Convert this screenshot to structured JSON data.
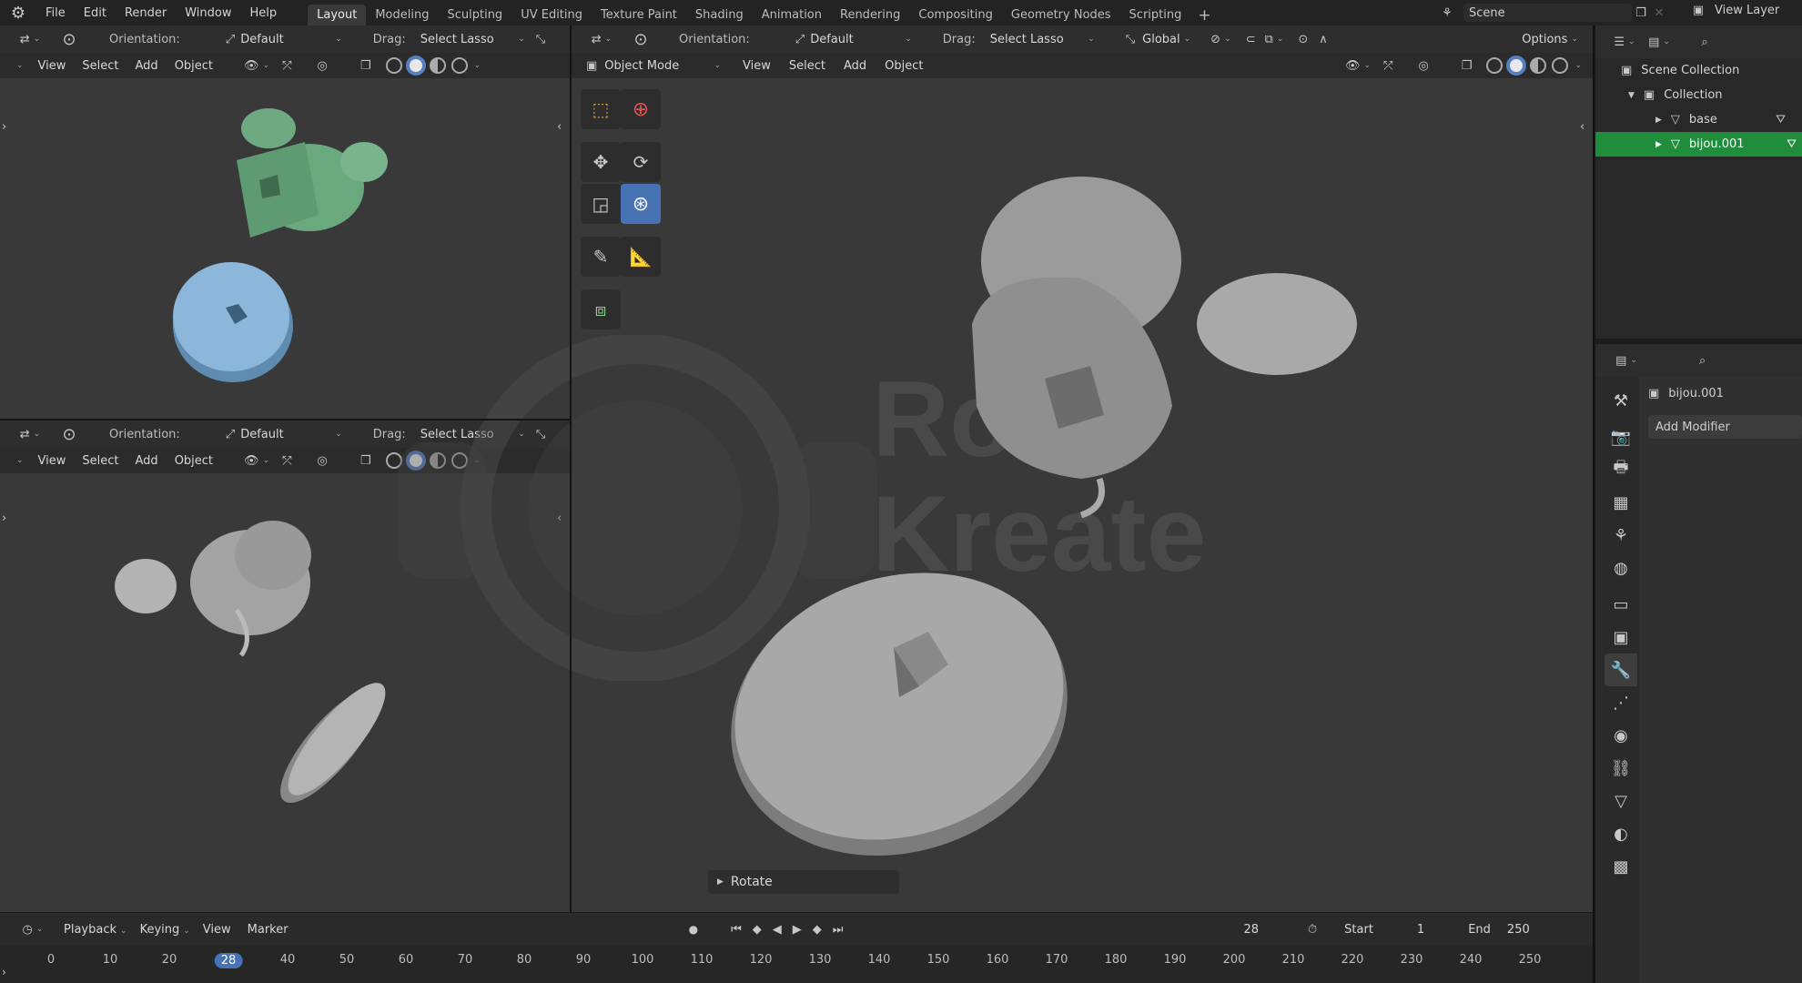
{
  "topbar": {
    "menu": [
      "File",
      "Edit",
      "Render",
      "Window",
      "Help"
    ],
    "workspaces": [
      "Layout",
      "Modeling",
      "Sculpting",
      "UV Editing",
      "Texture Paint",
      "Shading",
      "Animation",
      "Rendering",
      "Compositing",
      "Geometry Nodes",
      "Scripting"
    ],
    "active_workspace": "Layout",
    "add_tab": "+",
    "scene_label": "Scene",
    "view_layer_label": "View Layer"
  },
  "viewport_small": {
    "orientation_label": "Orientation:",
    "orientation_value": "Default",
    "drag_label": "Drag:",
    "drag_value": "Select Lasso",
    "menus": [
      "View",
      "Select",
      "Add",
      "Object"
    ]
  },
  "viewport_main": {
    "orientation_label": "Orientation:",
    "orientation_value": "Default",
    "drag_label": "Drag:",
    "drag_value": "Select Lasso",
    "transform_label": "Global",
    "options_label": "Options",
    "mode_label": "Object Mode",
    "menus": [
      "View",
      "Select",
      "Add",
      "Object"
    ],
    "operator_panel": "Rotate"
  },
  "watermark": {
    "line1": "Roud",
    "line2": "Kreate"
  },
  "outliner": {
    "root": "Scene Collection",
    "collection": "Collection",
    "items": [
      {
        "name": "base",
        "selected": false
      },
      {
        "name": "bijou.001",
        "selected": true
      }
    ]
  },
  "properties": {
    "object_name": "bijou.001",
    "add_modifier": "Add Modifier",
    "tabs": [
      "tool-icon",
      "render-icon",
      "output-icon",
      "view-layer-icon",
      "scene-icon",
      "world-icon",
      "collection-icon",
      "object-icon",
      "modifier-icon",
      "particles-icon",
      "physics-icon",
      "constraints-icon",
      "data-icon",
      "material-icon",
      "texture-icon"
    ],
    "active_tab": "modifier-icon"
  },
  "timeline": {
    "menus": [
      "Playback",
      "Keying",
      "View",
      "Marker"
    ],
    "current_frame": "28",
    "start_label": "Start",
    "start_value": "1",
    "end_label": "End",
    "end_value": "250",
    "ticks": [
      "0",
      "10",
      "20",
      "28",
      "40",
      "50",
      "60",
      "70",
      "80",
      "90",
      "100",
      "110",
      "120",
      "130",
      "140",
      "150",
      "160",
      "170",
      "180",
      "190",
      "200",
      "210",
      "220",
      "230",
      "240",
      "250"
    ]
  },
  "colors": {
    "accent_blue": "#4772b3",
    "selection_green": "#1f8d3b",
    "viewport_bg": "#393939"
  }
}
